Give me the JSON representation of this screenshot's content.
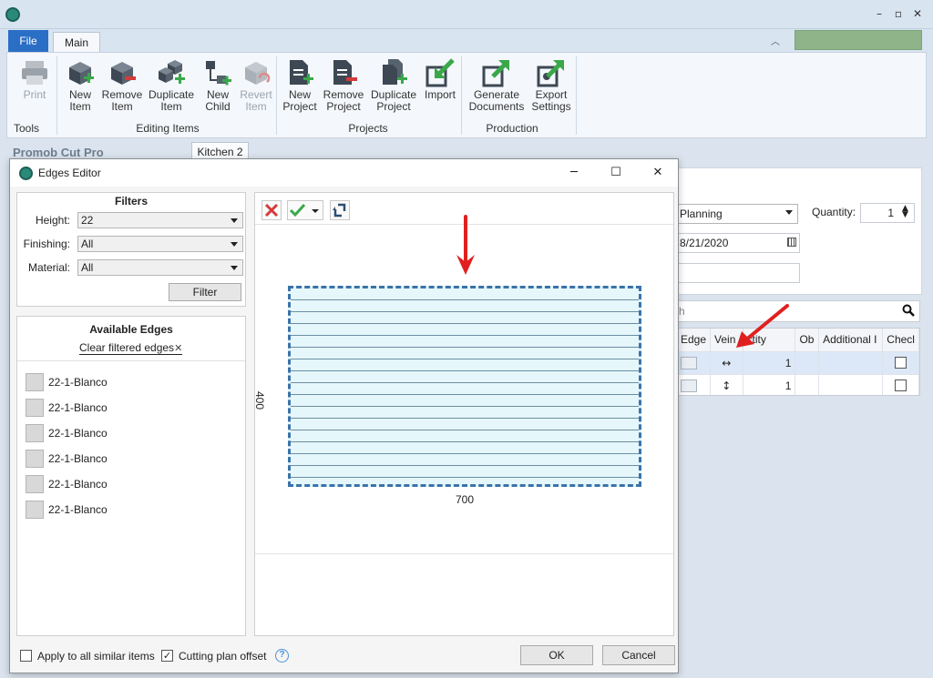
{
  "ribbon": {
    "tabs": {
      "file": "File",
      "main": "Main"
    },
    "groups": {
      "tools": "Tools",
      "editing": "Editing Items",
      "projects": "Projects",
      "production": "Production"
    },
    "buttons": {
      "print": [
        "Print"
      ],
      "new_item": [
        "New",
        "Item"
      ],
      "remove_item": [
        "Remove",
        "Item"
      ],
      "duplicate_item": [
        "Duplicate",
        "Item"
      ],
      "new_child": [
        "New",
        "Child"
      ],
      "revert_item": [
        "Revert",
        "Item"
      ],
      "new_project": [
        "New",
        "Project"
      ],
      "remove_project": [
        "Remove",
        "Project"
      ],
      "duplicate_project": [
        "Duplicate",
        "Project"
      ],
      "import": [
        "Import"
      ],
      "generate_documents": [
        "Generate",
        "Documents"
      ],
      "export_settings": [
        "Export",
        "Settings"
      ]
    }
  },
  "app": {
    "title": "Promob Cut Pro",
    "document_tab": "Kitchen 2"
  },
  "background_panel": {
    "status_value": "Planning",
    "quantity_label": "Quantity:",
    "quantity_value": "1",
    "date_value": "8/21/2020",
    "search_placeholder": "h",
    "columns": [
      "Edge",
      "Vein",
      "ctity",
      "Ob",
      "Additional I",
      "Checl"
    ],
    "rows": [
      {
        "vein": "↔",
        "qty": "1"
      },
      {
        "vein": "↕",
        "qty": "1"
      }
    ]
  },
  "dialog": {
    "title": "Edges Editor",
    "filters": {
      "heading": "Filters",
      "height_label": "Height:",
      "height_value": "22",
      "finishing_label": "Finishing:",
      "finishing_value": "All",
      "material_label": "Material:",
      "material_value": "All",
      "filter_button": "Filter"
    },
    "available_edges": {
      "heading": "Available Edges",
      "clear_link": "Clear filtered edges",
      "items": [
        "22-1-Blanco",
        "22-1-Blanco",
        "22-1-Blanco",
        "22-1-Blanco",
        "22-1-Blanco",
        "22-1-Blanco"
      ]
    },
    "preview": {
      "width_label": "700",
      "height_label": "400"
    },
    "footer": {
      "apply_all_label": "Apply to all similar items",
      "apply_all_checked": false,
      "cutting_offset_label": "Cutting plan offset",
      "cutting_offset_checked": true,
      "ok": "OK",
      "cancel": "Cancel"
    }
  },
  "colors": {
    "accent_blue": "#2b6ec5",
    "panel_fill": "#e6f7fb",
    "edge_dash": "#3a73a8",
    "arrow_red": "#e02020",
    "icon_green": "#3aa84a"
  }
}
